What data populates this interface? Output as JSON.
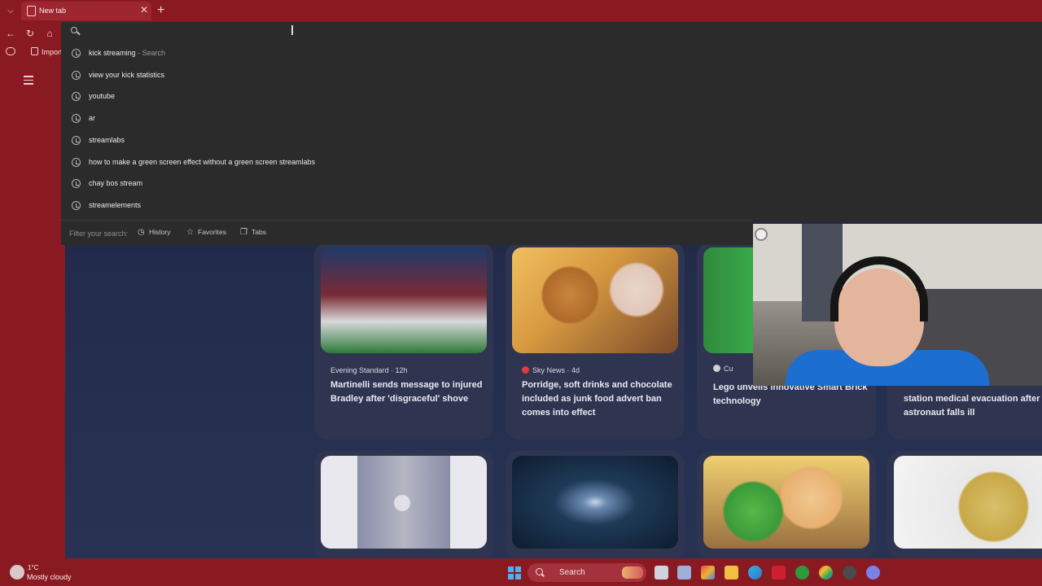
{
  "browser": {
    "tab_title": "New tab",
    "tab_close": "✕",
    "new_tab": "+",
    "tab_menu": "⌵",
    "bookmark_label": "Import"
  },
  "omnibox": {
    "suggestions": [
      {
        "text": "kick streaming",
        "hint": " - Search"
      },
      {
        "text": "view your kick statistics",
        "hint": ""
      },
      {
        "text": "youtube",
        "hint": ""
      },
      {
        "text": "ar",
        "hint": ""
      },
      {
        "text": "streamlabs",
        "hint": ""
      },
      {
        "text": "how to make a green screen effect without a green screen streamlabs",
        "hint": ""
      },
      {
        "text": "chay bos stream",
        "hint": ""
      },
      {
        "text": "streamelements",
        "hint": ""
      }
    ],
    "filter_placeholder": "Filter your search:",
    "filters": [
      {
        "label": "History",
        "icon": "history-icon"
      },
      {
        "label": "Favorites",
        "icon": "star-icon"
      },
      {
        "label": "Tabs",
        "icon": "tabs-icon"
      }
    ]
  },
  "news": [
    {
      "source": "Evening Standard · 12h",
      "headline": "Martinelli sends message to injured Bradley after 'disgraceful' shove",
      "accent": "#c8102e"
    },
    {
      "source": "Sky News · 4d",
      "headline": "Porridge, soft drinks and chocolate included as junk food advert ban comes into effect",
      "accent": "#e03c3c"
    },
    {
      "source": "Cu",
      "headline": "Lego unveils innovative Smart Brick technology",
      "accent": "#d0d0d0"
    },
    {
      "source": "",
      "headline": "station medical evacuation after astronaut falls ill",
      "accent": "#c0c0c0"
    }
  ],
  "taskbar": {
    "temperature": "1°C",
    "condition": "Mostly cloudy",
    "search_label": "Search"
  }
}
